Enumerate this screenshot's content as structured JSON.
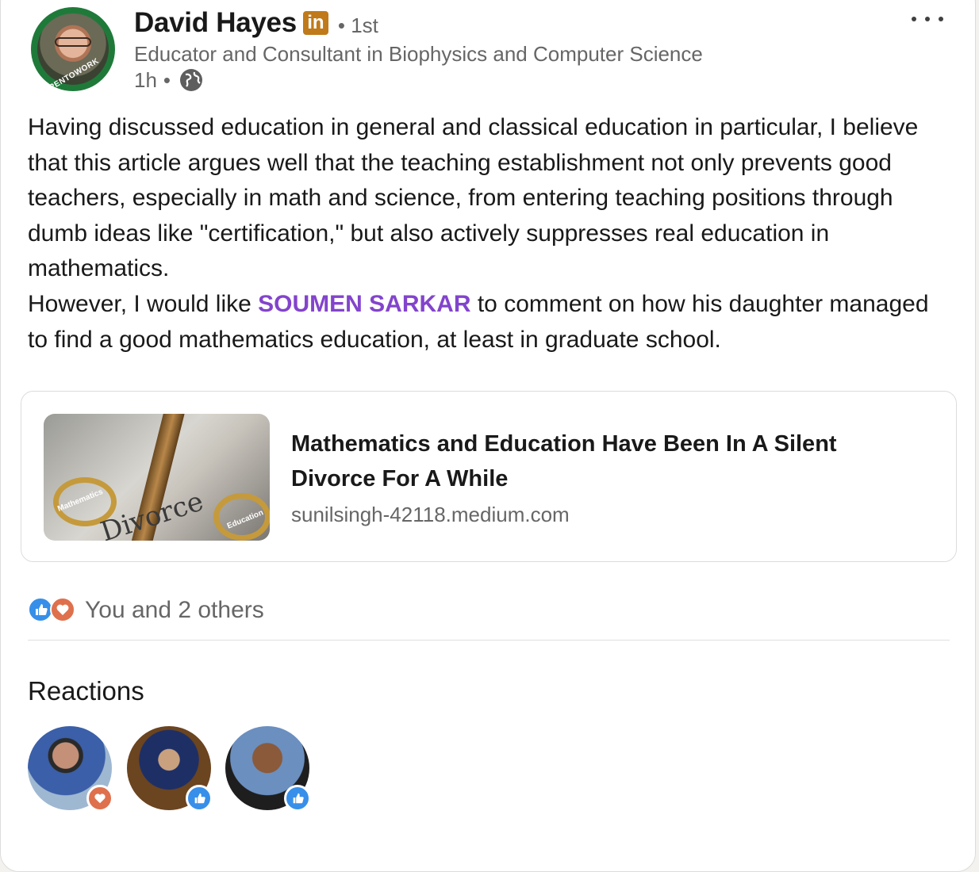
{
  "author": {
    "name": "David Hayes",
    "badge": "in",
    "degree": "• 1st",
    "headline": "Educator and Consultant in Biophysics and Computer Science",
    "time": "1h",
    "time_sep": "•",
    "visibility_icon": "globe-icon",
    "open_to_work": "#OPENTOWORK"
  },
  "post": {
    "text_before_mention": "Having discussed education in general and classical education in particular, I believe that this article argues well that the teaching establishment not only prevents good teachers, especially in math and science, from entering teaching positions through dumb ideas like \"certification,\" but also actively suppresses real education in mathematics.",
    "line2_before": "However, I would like ",
    "mention": "SOUMEN SARKAR",
    "line2_after": " to comment on how his daughter managed to find a good mathematics education, at least in graduate school."
  },
  "article": {
    "title": "Mathematics and Education Have Been In A Silent Divorce For A While",
    "source": "sunilsingh-42118.medium.com",
    "thumb_label_left": "Mathematics",
    "thumb_label_right": "Education",
    "thumb_word": "Divorce"
  },
  "social": {
    "icons": [
      "like-icon",
      "love-icon"
    ],
    "text": "You and 2 others"
  },
  "reactions": {
    "title": "Reactions",
    "people": [
      {
        "reaction": "love"
      },
      {
        "reaction": "like"
      },
      {
        "reaction": "like"
      }
    ]
  },
  "colors": {
    "mention": "#8344cc",
    "linkedin_badge": "#c07a1a",
    "like": "#378fe9",
    "love": "#df704d",
    "secondary_text": "#666666"
  }
}
